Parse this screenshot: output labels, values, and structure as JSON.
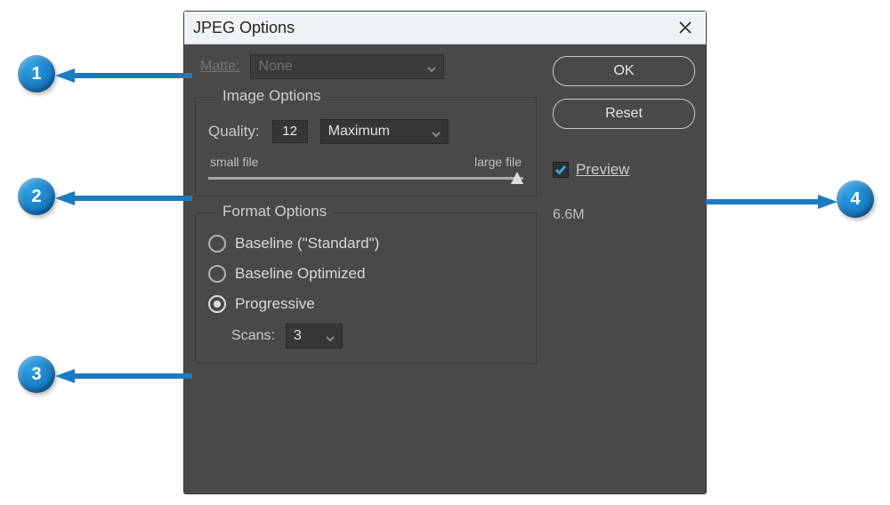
{
  "dialog": {
    "title": "JPEG Options"
  },
  "matte": {
    "label": "Matte:",
    "value": "None"
  },
  "image_options": {
    "group_title": "Image Options",
    "quality_label": "Quality:",
    "quality_value": "12",
    "preset_value": "Maximum",
    "slider_min_label": "small file",
    "slider_max_label": "large file"
  },
  "format_options": {
    "group_title": "Format Options",
    "options": [
      {
        "label": "Baseline (\"Standard\")"
      },
      {
        "label": "Baseline Optimized"
      },
      {
        "label": "Progressive"
      }
    ],
    "selected_index": 2,
    "scans_label": "Scans:",
    "scans_value": "3"
  },
  "buttons": {
    "ok": "OK",
    "reset": "Reset"
  },
  "preview": {
    "label": "Preview",
    "checked": true
  },
  "file_size": "6.6M",
  "callouts": [
    "1",
    "2",
    "3",
    "4"
  ]
}
